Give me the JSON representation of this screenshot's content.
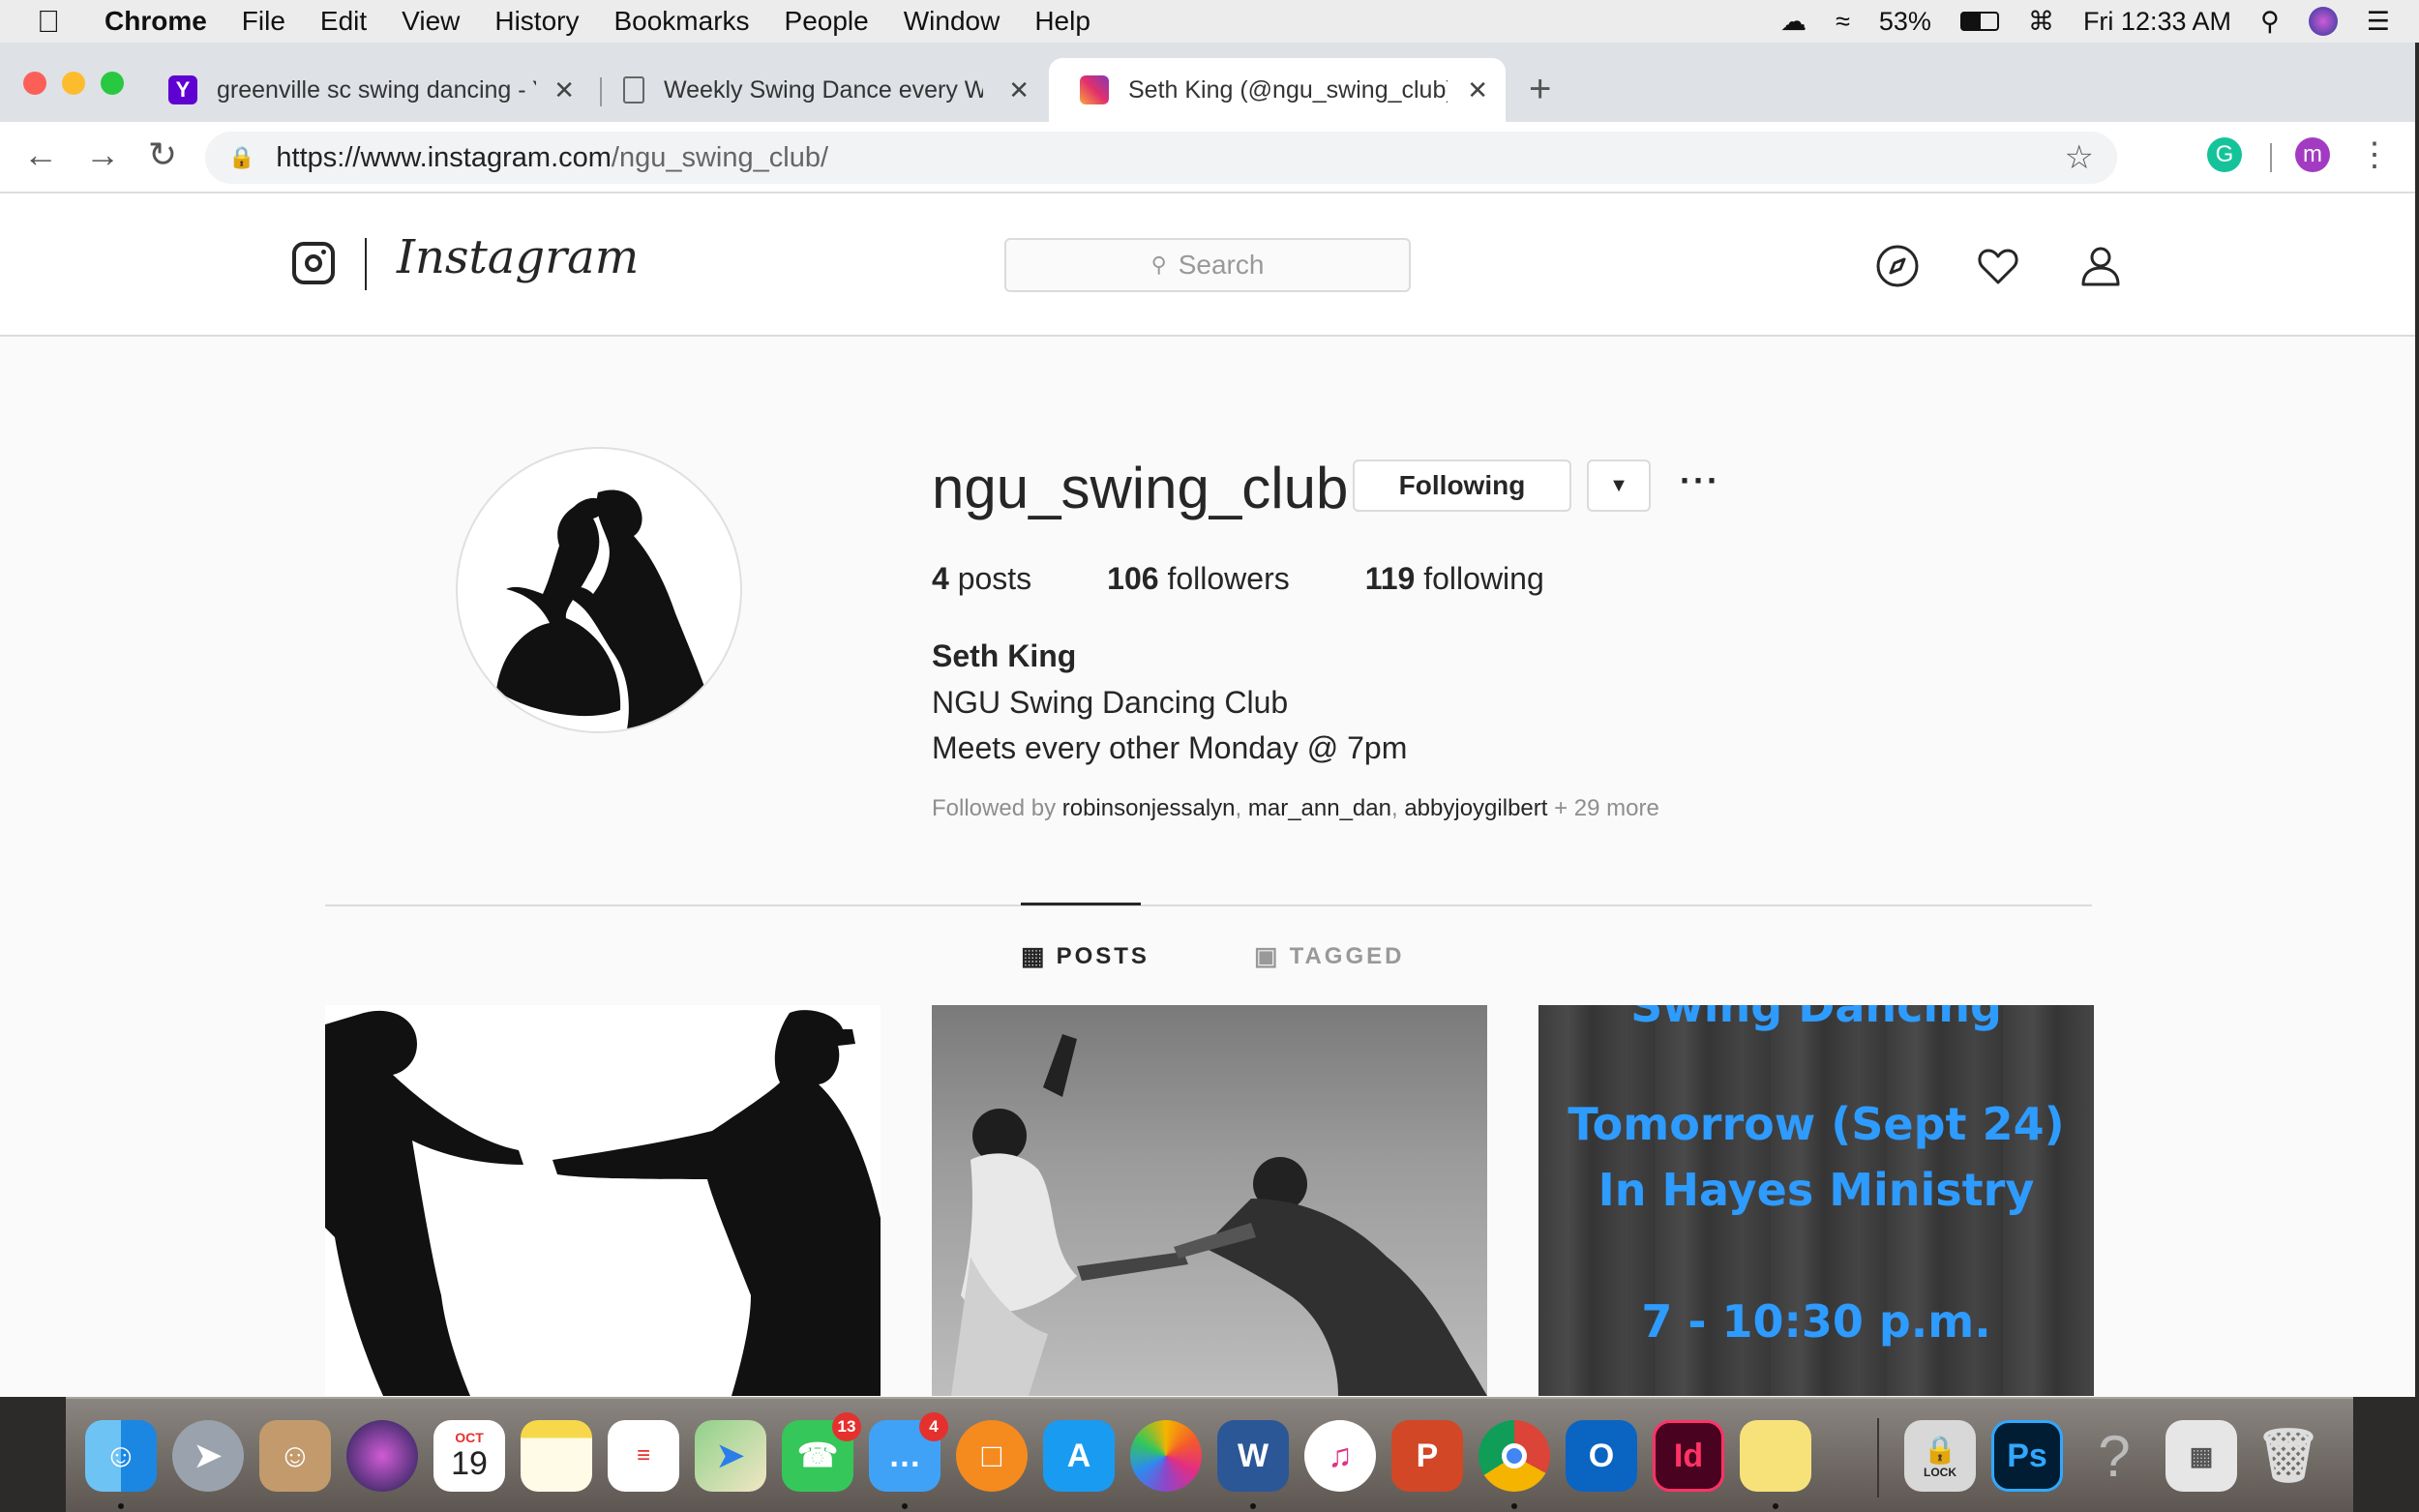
{
  "menubar": {
    "app_name": "Chrome",
    "menus": [
      "File",
      "Edit",
      "View",
      "History",
      "Bookmarks",
      "People",
      "Window",
      "Help"
    ],
    "battery": "53%",
    "clock": "Fri 12:33 AM"
  },
  "browser": {
    "tabs": [
      {
        "title": "greenville sc swing dancing - Y",
        "favicon": "yahoo-icon"
      },
      {
        "title": "Weekly Swing Dance every We",
        "favicon": "document-icon"
      },
      {
        "title": "Seth King (@ngu_swing_club) •",
        "favicon": "instagram-icon"
      }
    ],
    "url_host": "https://www.instagram.com",
    "url_path": "/ngu_swing_club/",
    "profile_initial": "m"
  },
  "instagram": {
    "wordmark": "Instagram",
    "search_placeholder": "Search"
  },
  "profile": {
    "username": "ngu_swing_club",
    "following_button": "Following",
    "posts_count": "4",
    "posts_label": "posts",
    "followers_count": "106",
    "followers_label": "followers",
    "following_count": "119",
    "following_label": "following",
    "full_name": "Seth King",
    "bio_line1": "NGU Swing Dancing Club",
    "bio_line2": "Meets every other Monday @ 7pm",
    "followed_by_prefix": "Followed by",
    "followed_by": [
      "robinsonjessalyn",
      "mar_ann_dan",
      "abbyjoygilbert"
    ],
    "followed_by_more": "+ 29 more"
  },
  "profile_tabs": {
    "posts": "POSTS",
    "tagged": "TAGGED"
  },
  "posts": {
    "post3_line0": "Swing Dancing",
    "post3_line1": "Tomorrow (Sept 24)",
    "post3_line2": "In Hayes Ministry",
    "post3_line3": "7 - 10:30 p.m."
  },
  "dock": {
    "calendar_month": "OCT",
    "calendar_day": "19",
    "facetime_badge": "13",
    "messages_badge": "4",
    "lock_label": "LOCK"
  },
  "colors": {
    "ig_text": "#262626",
    "ig_border": "#dbdbdb",
    "post_text_blue": "#2e9bff"
  }
}
